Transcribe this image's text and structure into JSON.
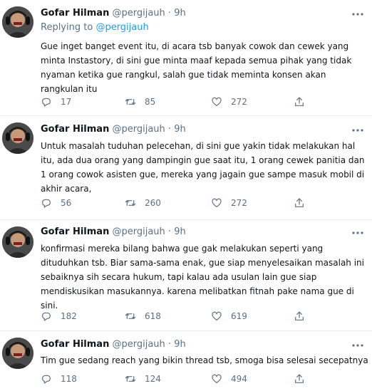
{
  "author": {
    "name": "Gofar Hilman",
    "handle": "@pergijauh",
    "separator": "·",
    "time": "9h"
  },
  "replying": {
    "prefix": "Replying to",
    "mention": "@pergijauh"
  },
  "tweets": [
    {
      "text": "Gue inget banget event itu, di acara tsb banyak cowok dan cewek yang minta Instastory, di sini gue minta maaf kepada semua pihak yang tidak nyaman ketika gue rangkul, salah gue tidak meminta konsen akan rangkulan itu",
      "replies": "17",
      "retweets": "85",
      "likes": "272"
    },
    {
      "text": "Untuk masalah tuduhan pelecehan, di sini gue yakin tidak melakukan hal itu, ada dua orang yang dampingin gue saat itu, 1 orang cewek panitia dan 1 orang cowok asisten gue,  mereka yang jagain gue sampe masuk mobil di akhir acara,",
      "replies": "56",
      "retweets": "260",
      "likes": "272"
    },
    {
      "text": "konfirmasi mereka bilang bahwa gue gak melakukan seperti yang dituduhkan tsb. Biar sama-sama enak, gue siap menyelesaikan masalah ini sebaiknya sih secara hukum, tapi kalau ada usulan lain gue siap mendiskusikan masukannya. karena melibatkan fitnah pake nama gue di sini.",
      "replies": "182",
      "retweets": "618",
      "likes": "619"
    },
    {
      "text": "Tim gue sedang reach yang bikin thread tsb, smoga bisa selesai secepatnya",
      "replies": "118",
      "retweets": "124",
      "likes": "494"
    }
  ],
  "colors": {
    "text": "#0f1419",
    "muted": "#5b7083",
    "link": "#1d9bf0",
    "divider": "#e6ecf0"
  },
  "icons": [
    "more-icon",
    "reply-icon",
    "retweet-icon",
    "like-icon",
    "share-icon"
  ]
}
